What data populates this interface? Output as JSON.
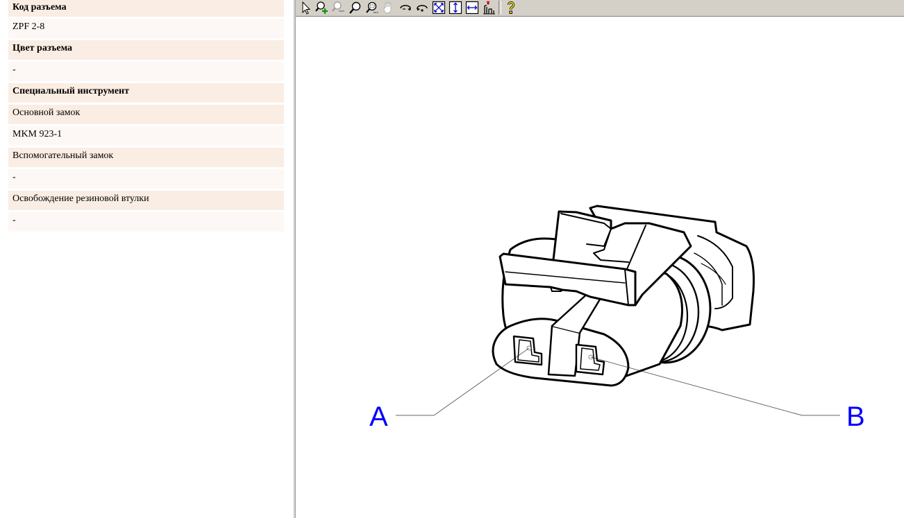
{
  "info": {
    "rows": [
      {
        "kind": "head",
        "text": "Код разъема"
      },
      {
        "kind": "val",
        "text": "ZPF 2-8"
      },
      {
        "kind": "head",
        "text": "Цвет разъема"
      },
      {
        "kind": "val",
        "text": "-"
      },
      {
        "kind": "head",
        "text": "Специальный инструмент"
      },
      {
        "kind": "sub",
        "text": "Основной замок"
      },
      {
        "kind": "val",
        "text": "MKM 923-1"
      },
      {
        "kind": "sub",
        "text": "Вспомогательный замок"
      },
      {
        "kind": "val",
        "text": "-"
      },
      {
        "kind": "sub",
        "text": "Освобождение резиновой втулки"
      },
      {
        "kind": "val",
        "text": "-"
      }
    ]
  },
  "toolbar": {
    "buttons": [
      {
        "icon": "select-arrow-icon"
      },
      {
        "icon": "zoom-in-icon"
      },
      {
        "icon": "zoom-out-icon"
      },
      {
        "icon": "zoom-icon"
      },
      {
        "icon": "zoom-window-icon"
      },
      {
        "icon": "pan-hand-icon"
      },
      {
        "icon": "rotate-clockwise-icon"
      },
      {
        "icon": "rotate-counterclockwise-icon"
      },
      {
        "icon": "fit-all-icon"
      },
      {
        "icon": "fit-height-icon"
      },
      {
        "icon": "fit-width-icon"
      },
      {
        "icon": "hyperlink-icon"
      },
      {
        "icon": "help-icon"
      }
    ]
  },
  "drawing": {
    "callouts": {
      "a": "A",
      "b": "B"
    },
    "callout_color": "#0000ff"
  }
}
